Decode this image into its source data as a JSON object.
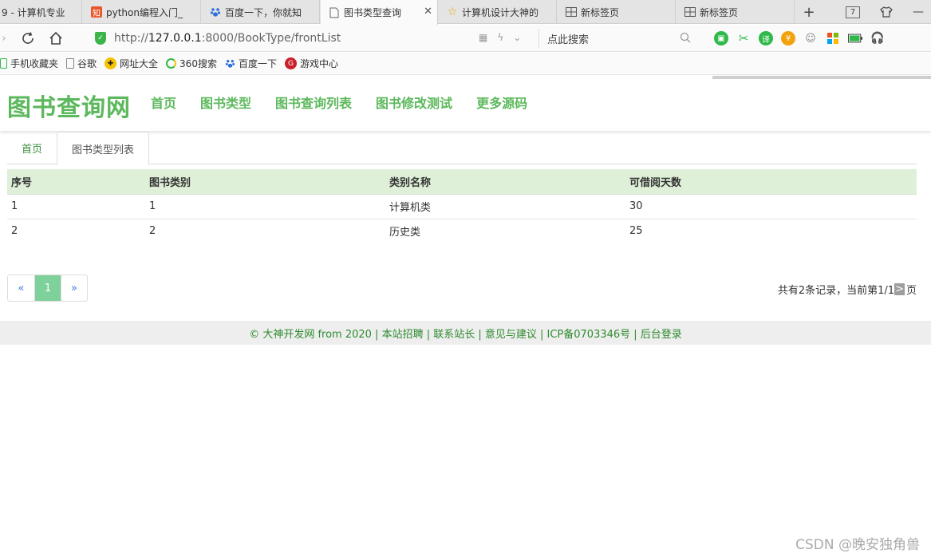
{
  "browser": {
    "tabs": [
      {
        "title": "9 - 计算机专业",
        "icon": "page-icon"
      },
      {
        "title": "python编程入门_",
        "icon": "zhihu-icon"
      },
      {
        "title": "百度一下，你就知",
        "icon": "baidu-paw-icon"
      },
      {
        "title": "图书类型查询",
        "icon": "document-icon",
        "active": true
      },
      {
        "title": "计算机设计大神的",
        "icon": "star-icon"
      },
      {
        "title": "新标签页",
        "icon": "grid-icon"
      },
      {
        "title": "新标签页",
        "icon": "grid-icon"
      }
    ],
    "tab_count": "7",
    "url_prefix": "http://",
    "url_host": "127.0.0.1",
    "url_rest": ":8000/BookType/frontList",
    "search_placeholder": "点此搜索",
    "bookmarks": [
      {
        "label": "手机收藏夹",
        "icon": "phone-icon"
      },
      {
        "label": "谷歌",
        "icon": "page-icon"
      },
      {
        "label": "网址大全",
        "icon": "hao123-icon"
      },
      {
        "label": "360搜索",
        "icon": "360-icon"
      },
      {
        "label": "百度一下",
        "icon": "baidu-paw-icon"
      },
      {
        "label": "游戏中心",
        "icon": "game-icon"
      }
    ]
  },
  "site": {
    "brand": "图书查询网",
    "nav": [
      "首页",
      "图书类型",
      "图书查询列表",
      "图书修改测试",
      "更多源码"
    ],
    "subtabs": [
      "首页",
      "图书类型列表"
    ],
    "table": {
      "headers": [
        "序号",
        "图书类别",
        "类别名称",
        "可借阅天数"
      ],
      "rows": [
        [
          "1",
          "1",
          "计算机类",
          "30"
        ],
        [
          "2",
          "2",
          "历史类",
          "25"
        ]
      ]
    },
    "pager": {
      "prev": "«",
      "current": "1",
      "next": "»"
    },
    "record_info_a": "共有2条记录，当前第1/1",
    "record_info_sel": ">",
    "record_info_b": " 页",
    "footer": "© 大神开发网 from 2020 | 本站招聘 | 联系站长 | 意见与建议 | ICP备0703346号 | 后台登录"
  },
  "watermark": "CSDN @晚安独角兽",
  "colors": {
    "brand_green": "#5cb85c",
    "header_row": "#dff0d8",
    "pager_active": "#7ed19a"
  }
}
